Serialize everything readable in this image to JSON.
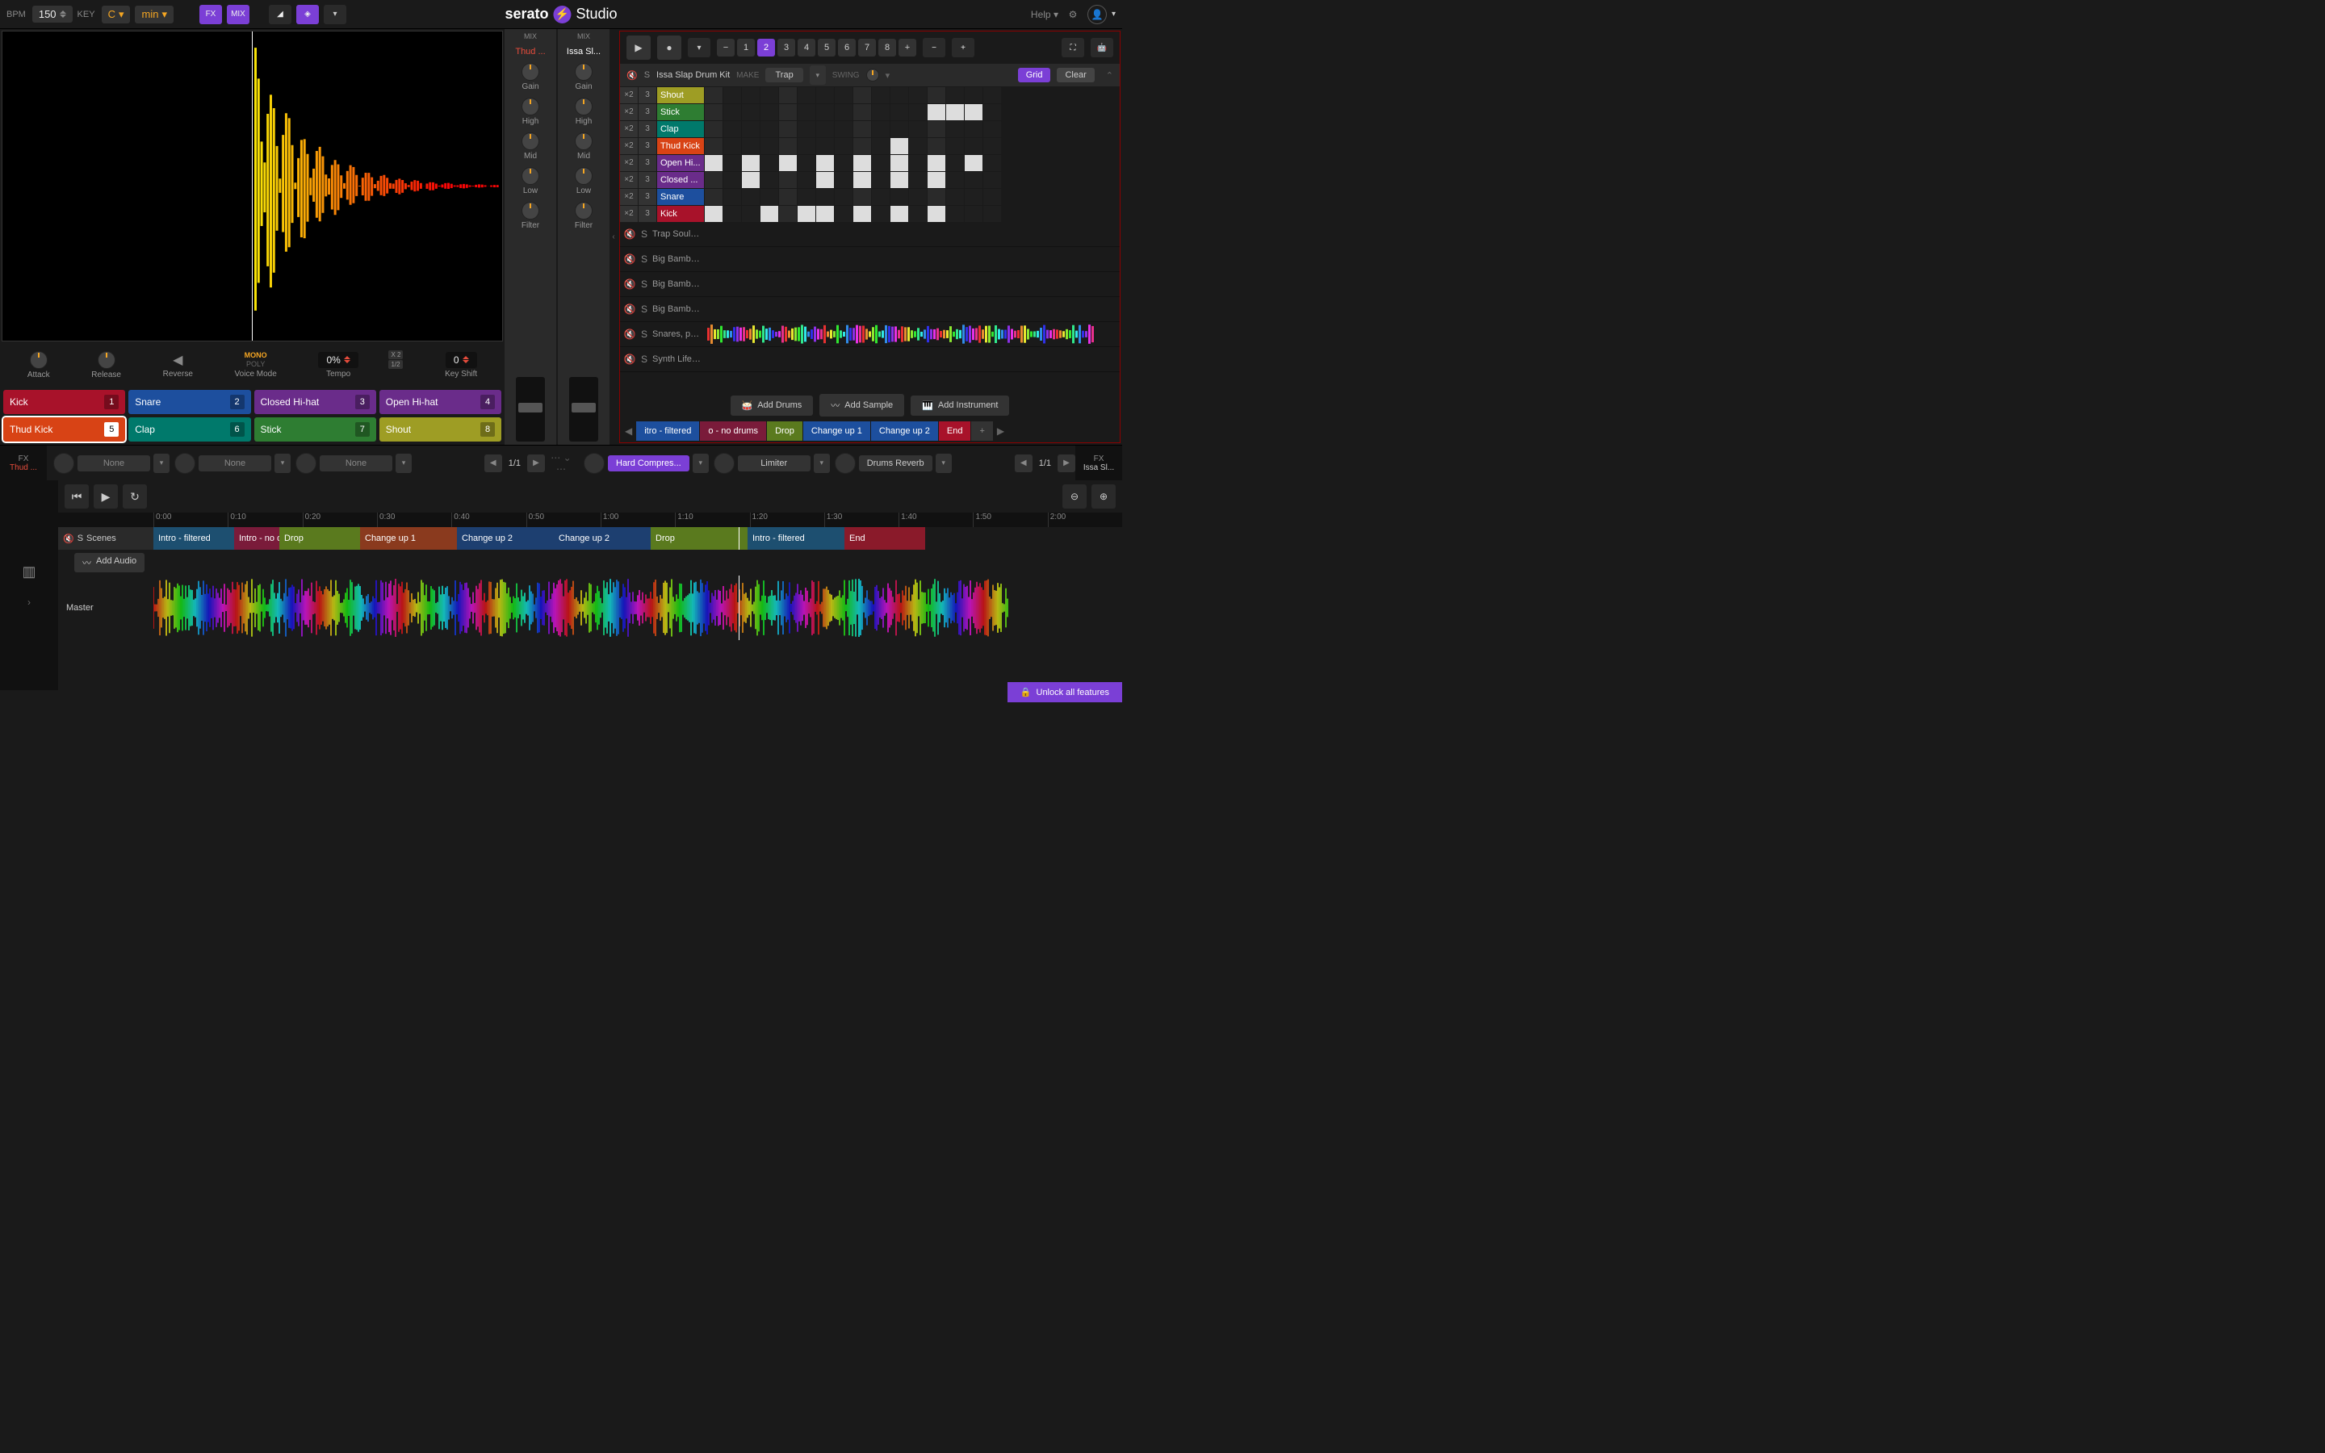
{
  "app": {
    "brand": "serato",
    "product": "Studio",
    "help": "Help"
  },
  "topbar": {
    "bpm_label": "BPM",
    "bpm": "150",
    "key_label": "KEY",
    "key": "C",
    "scale": "min",
    "fx": "FX",
    "mix": "MIX"
  },
  "sample": {
    "attack": "Attack",
    "release": "Release",
    "reverse": "Reverse",
    "voice": "Voice Mode",
    "mono": "MONO",
    "poly": "POLY",
    "tempo": "Tempo",
    "tempo_val": "0%",
    "keyshift": "Key Shift",
    "keyshift_val": "0"
  },
  "pads": [
    {
      "name": "Kick",
      "n": "1",
      "c": "#a8122a"
    },
    {
      "name": "Snare",
      "n": "2",
      "c": "#1d4f9e"
    },
    {
      "name": "Closed Hi-hat",
      "n": "3",
      "c": "#6a2c8a"
    },
    {
      "name": "Open Hi-hat",
      "n": "4",
      "c": "#6a2c8a"
    },
    {
      "name": "Thud Kick",
      "n": "5",
      "c": "#d84315"
    },
    {
      "name": "Clap",
      "n": "6",
      "c": "#00796b"
    },
    {
      "name": "Stick",
      "n": "7",
      "c": "#2e7d32"
    },
    {
      "name": "Shout",
      "n": "8",
      "c": "#9e9d24"
    }
  ],
  "mix": {
    "hdr": "MIX",
    "strips": [
      {
        "name": "Thud ...",
        "red": true
      },
      {
        "name": "Issa Sl..."
      }
    ],
    "knobs": [
      "Gain",
      "High",
      "Mid",
      "Low",
      "Filter"
    ]
  },
  "sequencer": {
    "scenes": [
      "1",
      "2",
      "3",
      "4",
      "5",
      "6",
      "7",
      "8"
    ],
    "active": "2",
    "kit": "Issa Slap Drum Kit",
    "make": "MAKE",
    "genre": "Trap",
    "swing": "SWING",
    "grid": "Grid",
    "clear": "Clear",
    "x2": "×2",
    "x3": "3",
    "drums": [
      {
        "name": "Shout",
        "c": "#9e9d24",
        "steps": []
      },
      {
        "name": "Stick",
        "c": "#2e7d32",
        "steps": [
          12,
          13,
          14
        ]
      },
      {
        "name": "Clap",
        "c": "#00796b",
        "steps": []
      },
      {
        "name": "Thud Kick",
        "c": "#d84315",
        "steps": [
          10
        ]
      },
      {
        "name": "Open Hi...",
        "c": "#6a2c8a",
        "steps": [
          0,
          2,
          4,
          6,
          8,
          10,
          12,
          14
        ]
      },
      {
        "name": "Closed ...",
        "c": "#6a2c8a",
        "steps": [
          2,
          6,
          8,
          10,
          12
        ]
      },
      {
        "name": "Snare",
        "c": "#1d4f9e",
        "steps": []
      },
      {
        "name": "Kick",
        "c": "#a8122a",
        "steps": [
          0,
          3,
          5,
          6,
          8,
          10,
          12
        ]
      }
    ],
    "tracks": [
      {
        "name": "Trap Soul Dr..."
      },
      {
        "name": "Big Bamboo-..."
      },
      {
        "name": "Big Bamboo-..."
      },
      {
        "name": "Big Bamboo-..."
      },
      {
        "name": "Snares, perc ...",
        "wave": true
      },
      {
        "name": "Synth Life F..."
      }
    ],
    "add_drums": "Add Drums",
    "add_sample": "Add Sample",
    "add_instr": "Add Instrument",
    "scene_chips": [
      {
        "name": "itro - filtered",
        "c": "#1d4f9e"
      },
      {
        "name": "o - no drums",
        "c": "#7a1b3a"
      },
      {
        "name": "Drop",
        "c": "#5a7a1e"
      },
      {
        "name": "Change up 1",
        "c": "#1d4f9e"
      },
      {
        "name": "Change up 2",
        "c": "#1d4f9e"
      },
      {
        "name": "End",
        "c": "#a8122a"
      }
    ]
  },
  "fx": {
    "left": {
      "label": "FX",
      "name": "Thud ...",
      "slots": [
        "None",
        "None",
        "None"
      ],
      "page": "1/1"
    },
    "right": {
      "label": "FX",
      "name": "Issa Sl...",
      "slots": [
        "Hard Compres...",
        "Limiter",
        "Drums Reverb"
      ],
      "page": "1/1"
    }
  },
  "timeline": {
    "ticks": [
      "0:00",
      "0:10",
      "0:20",
      "0:30",
      "0:40",
      "0:50",
      "1:00",
      "1:10",
      "1:20",
      "1:30",
      "1:40",
      "1:50",
      "2:00"
    ],
    "scenes_hdr": "Scenes",
    "blocks": [
      {
        "name": "Intro - filtered",
        "c": "#1d4f70",
        "w": 100
      },
      {
        "name": "Intro - no dr",
        "c": "#7a1b3a",
        "w": 56
      },
      {
        "name": "Drop",
        "c": "#5a7a1e",
        "w": 100
      },
      {
        "name": "Change up 1",
        "c": "#8a3a1e",
        "w": 120
      },
      {
        "name": "Change up 2",
        "c": "#1d3f70",
        "w": 120
      },
      {
        "name": "Change up 2",
        "c": "#1d3f70",
        "w": 120
      },
      {
        "name": "Drop",
        "c": "#5a7a1e",
        "w": 120
      },
      {
        "name": "Intro - filtered",
        "c": "#1d4f70",
        "w": 120
      },
      {
        "name": "End",
        "c": "#8a1a2a",
        "w": 100
      }
    ],
    "add_audio": "Add Audio",
    "master": "Master",
    "unlock": "Unlock all features"
  }
}
